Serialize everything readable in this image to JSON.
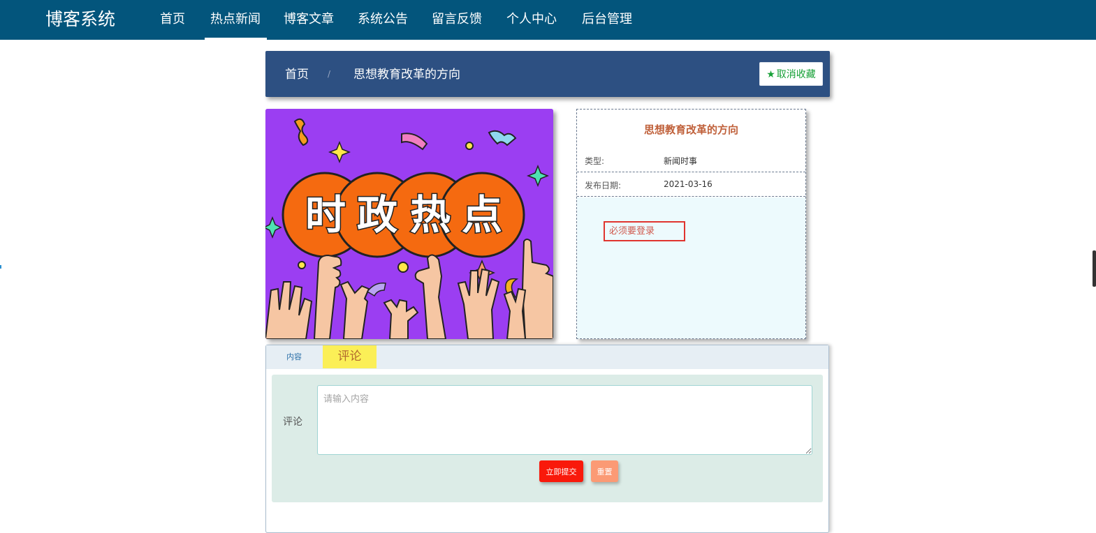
{
  "nav": {
    "brand": "博客系统",
    "items": [
      {
        "label": "首页"
      },
      {
        "label": "热点新闻"
      },
      {
        "label": "博客文章"
      },
      {
        "label": "系统公告"
      },
      {
        "label": "留言反馈"
      },
      {
        "label": "个人中心"
      },
      {
        "label": "后台管理"
      }
    ],
    "active_index": 1
  },
  "breadcrumb": {
    "home": "首页",
    "separator": "/",
    "current": "思想教育改革的方向",
    "favorite_button": "取消收藏"
  },
  "poster": {
    "text": "时政热点",
    "icon": "news-poster-image"
  },
  "info": {
    "title": "思想教育改革的方向",
    "type_label": "类型:",
    "type_value": "新闻时事",
    "date_label": "发布日期:",
    "date_value": "2021-03-16",
    "login_notice": "必须要登录"
  },
  "tabs": {
    "content": "内容",
    "comment": "评论"
  },
  "comment_form": {
    "label": "评论",
    "placeholder": "请输入内容",
    "submit": "立即提交",
    "reset": "重置"
  },
  "colors": {
    "nav_bg": "#03557c",
    "breadcrumb_bg": "#2d5082",
    "favorite_text": "#16a036",
    "info_title": "#c0613b",
    "submit_bg": "#f9190b",
    "reset_bg": "#fb9a75",
    "active_tab_bg": "#fbef57",
    "poster_bg": "#9b3ef2"
  }
}
